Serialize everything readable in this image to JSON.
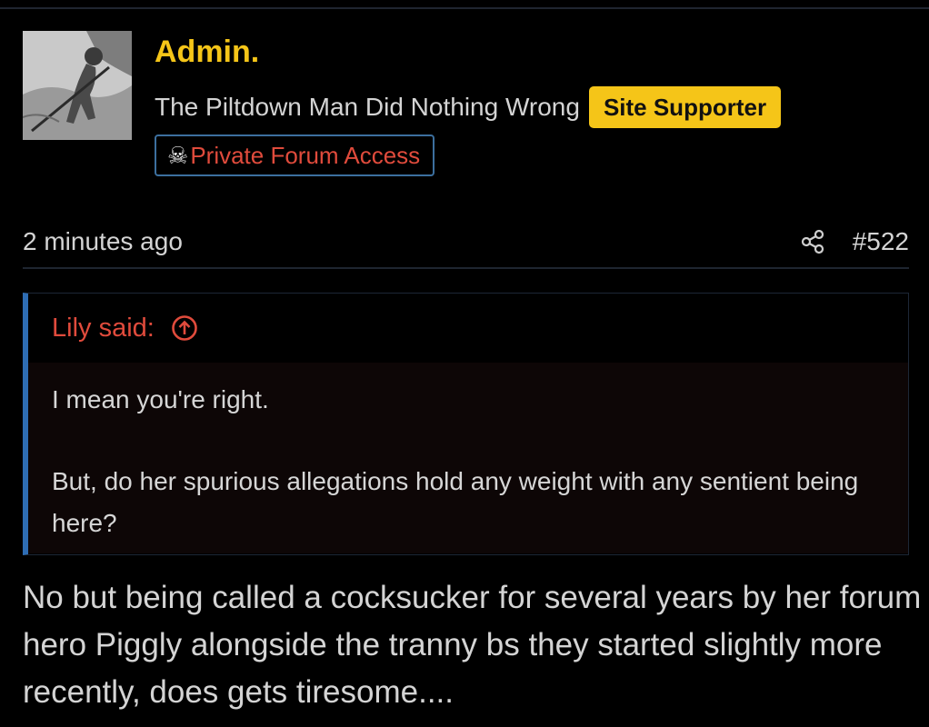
{
  "user": {
    "name": "Admin.",
    "title": "The Piltdown Man Did Nothing Wrong",
    "badge_supporter": "Site Supporter",
    "badge_private_icon": "☠",
    "badge_private": "Private Forum Access",
    "avatar_icon": "avatar-image"
  },
  "post": {
    "time": "2 minutes ago",
    "share_icon": "share-icon",
    "number": "#522",
    "body": "No but being called a cocksucker for several years by her forum hero Piggly alongside the tranny bs they started slightly more recently, does gets tiresome...."
  },
  "quote": {
    "author": "Lily said:",
    "arrow_icon": "arrow-up-circle-icon",
    "paragraphs": [
      "I mean you're right.",
      "But, do her spurious allegations hold any weight with any sentient being here?"
    ]
  },
  "colors": {
    "background": "#000000",
    "username": "#f5c518",
    "badge_supporter_bg": "#f5c518",
    "accent_red": "#e04b3c",
    "quote_border": "#2e6db4",
    "badge_border": "#3c6f9e"
  }
}
